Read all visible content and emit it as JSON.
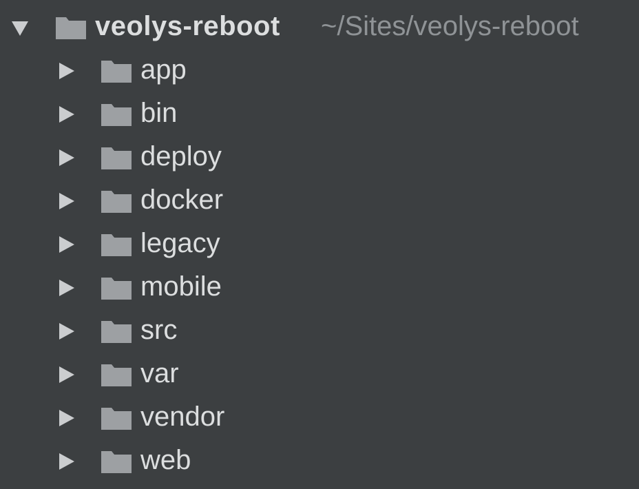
{
  "project_tree": {
    "root": {
      "name": "veolys-reboot",
      "path": "~/Sites/veolys-reboot",
      "expanded": true,
      "icon": "folder-icon"
    },
    "children": [
      {
        "name": "app",
        "icon": "folder-icon",
        "expanded": false
      },
      {
        "name": "bin",
        "icon": "folder-icon",
        "expanded": false
      },
      {
        "name": "deploy",
        "icon": "folder-icon",
        "expanded": false
      },
      {
        "name": "docker",
        "icon": "folder-icon",
        "expanded": false
      },
      {
        "name": "legacy",
        "icon": "folder-icon",
        "expanded": false
      },
      {
        "name": "mobile",
        "icon": "folder-icon",
        "expanded": false
      },
      {
        "name": "src",
        "icon": "folder-icon",
        "expanded": false
      },
      {
        "name": "var",
        "icon": "folder-icon",
        "expanded": false
      },
      {
        "name": "vendor",
        "icon": "folder-icon",
        "expanded": false
      },
      {
        "name": "web",
        "icon": "folder-icon",
        "expanded": false
      }
    ]
  },
  "colors": {
    "background": "#3c3f41",
    "text": "#dcdedf",
    "path_text": "#8f9396",
    "folder": "#9da0a3",
    "arrow": "#cbcdcf"
  }
}
